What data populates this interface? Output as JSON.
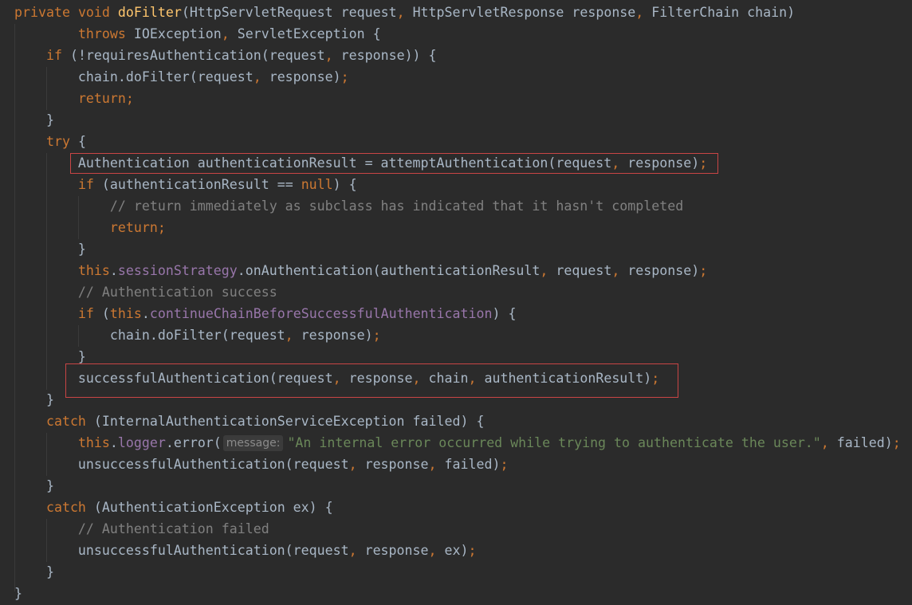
{
  "editor": {
    "lines": [
      [
        [
          "kw",
          "private "
        ],
        [
          "kw",
          "void "
        ],
        [
          "fn",
          "doFilter"
        ],
        [
          "",
          "(HttpServletRequest request"
        ],
        [
          "p",
          ", "
        ],
        [
          "",
          "HttpServletResponse response"
        ],
        [
          "p",
          ", "
        ],
        [
          "",
          "FilterChain chain)"
        ]
      ],
      [
        [
          "",
          "        "
        ],
        [
          "kw",
          "throws "
        ],
        [
          "",
          "IOException"
        ],
        [
          "p",
          ", "
        ],
        [
          "",
          "ServletException {"
        ]
      ],
      [
        [
          "",
          "    "
        ],
        [
          "kw",
          "if "
        ],
        [
          "",
          "(!requiresAuthentication(request"
        ],
        [
          "p",
          ", "
        ],
        [
          "",
          "response)) {"
        ]
      ],
      [
        [
          "",
          "        chain.doFilter(request"
        ],
        [
          "p",
          ", "
        ],
        [
          "",
          "response)"
        ],
        [
          "p",
          ";"
        ]
      ],
      [
        [
          "",
          "        "
        ],
        [
          "kw",
          "return"
        ],
        [
          "p",
          ";"
        ]
      ],
      [
        [
          "",
          "    }"
        ]
      ],
      [
        [
          "",
          "    "
        ],
        [
          "kw",
          "try "
        ],
        [
          "",
          "{"
        ]
      ],
      [
        [
          "",
          "        Authentication authenticationResult = attemptAuthentication(request"
        ],
        [
          "p",
          ", "
        ],
        [
          "",
          "response)"
        ],
        [
          "p",
          ";"
        ]
      ],
      [
        [
          "",
          "        "
        ],
        [
          "kw",
          "if "
        ],
        [
          "",
          "(authenticationResult == "
        ],
        [
          "kw",
          "null"
        ],
        [
          "",
          ") {"
        ]
      ],
      [
        [
          "cmt",
          "            // return immediately as subclass has indicated that it hasn't completed"
        ]
      ],
      [
        [
          "",
          "            "
        ],
        [
          "kw",
          "return"
        ],
        [
          "p",
          ";"
        ]
      ],
      [
        [
          "",
          "        }"
        ]
      ],
      [
        [
          "",
          "        "
        ],
        [
          "kw",
          "this"
        ],
        [
          "",
          "."
        ],
        [
          "fld",
          "sessionStrategy"
        ],
        [
          "",
          ".onAuthentication(authenticationResult"
        ],
        [
          "p",
          ", "
        ],
        [
          "",
          "request"
        ],
        [
          "p",
          ", "
        ],
        [
          "",
          "response)"
        ],
        [
          "p",
          ";"
        ]
      ],
      [
        [
          "cmt",
          "        // Authentication success"
        ]
      ],
      [
        [
          "",
          "        "
        ],
        [
          "kw",
          "if "
        ],
        [
          "",
          "("
        ],
        [
          "kw",
          "this"
        ],
        [
          "",
          "."
        ],
        [
          "fld",
          "continueChainBeforeSuccessfulAuthentication"
        ],
        [
          "",
          ") {"
        ]
      ],
      [
        [
          "",
          "            chain.doFilter(request"
        ],
        [
          "p",
          ", "
        ],
        [
          "",
          "response)"
        ],
        [
          "p",
          ";"
        ]
      ],
      [
        [
          "",
          "        }"
        ]
      ],
      [
        [
          "",
          "        successfulAuthentication(request"
        ],
        [
          "p",
          ", "
        ],
        [
          "",
          "response"
        ],
        [
          "p",
          ", "
        ],
        [
          "",
          "chain"
        ],
        [
          "p",
          ", "
        ],
        [
          "",
          "authenticationResult)"
        ],
        [
          "p",
          ";"
        ]
      ],
      [
        [
          "",
          "    }"
        ]
      ],
      [
        [
          "",
          "    "
        ],
        [
          "kw",
          "catch "
        ],
        [
          "",
          "(InternalAuthenticationServiceException failed) {"
        ]
      ],
      [
        [
          "",
          "        "
        ],
        [
          "kw",
          "this"
        ],
        [
          "",
          "."
        ],
        [
          "fld",
          "logger"
        ],
        [
          "",
          ".error("
        ],
        [
          "hint",
          "message:"
        ],
        [
          "str",
          "\"An internal error occurred while trying to authenticate the user.\""
        ],
        [
          "p",
          ", "
        ],
        [
          "",
          "failed)"
        ],
        [
          "p",
          ";"
        ]
      ],
      [
        [
          "",
          "        unsuccessfulAuthentication(request"
        ],
        [
          "p",
          ", "
        ],
        [
          "",
          "response"
        ],
        [
          "p",
          ", "
        ],
        [
          "",
          "failed)"
        ],
        [
          "p",
          ";"
        ]
      ],
      [
        [
          "",
          "    }"
        ]
      ],
      [
        [
          "",
          "    "
        ],
        [
          "kw",
          "catch "
        ],
        [
          "",
          "(AuthenticationException ex) {"
        ]
      ],
      [
        [
          "cmt",
          "        // Authentication failed"
        ]
      ],
      [
        [
          "",
          "        unsuccessfulAuthentication(request"
        ],
        [
          "p",
          ", "
        ],
        [
          "",
          "response"
        ],
        [
          "p",
          ", "
        ],
        [
          "",
          "ex)"
        ],
        [
          "p",
          ";"
        ]
      ],
      [
        [
          "",
          "    }"
        ]
      ],
      [
        [
          "",
          "}"
        ]
      ]
    ]
  }
}
